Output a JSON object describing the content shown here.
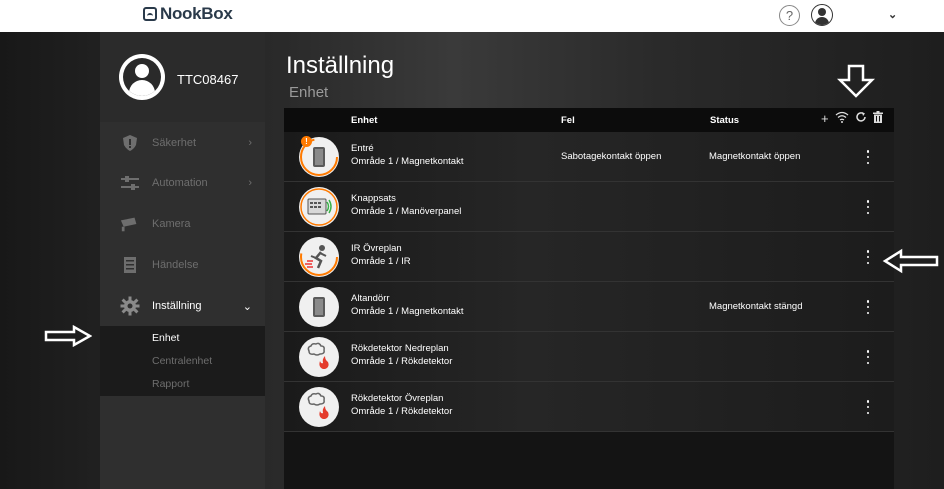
{
  "app": {
    "logo_text": "NookBox"
  },
  "header": {
    "help_label": "?"
  },
  "sidebar": {
    "username": "TTC08467",
    "items": [
      {
        "label": "Säkerhet",
        "icon": "shield-icon",
        "chevron": "›"
      },
      {
        "label": "Automation",
        "icon": "sliders-icon",
        "chevron": "›"
      },
      {
        "label": "Kamera",
        "icon": "camera-icon",
        "chevron": ""
      },
      {
        "label": "Händelse",
        "icon": "log-icon",
        "chevron": ""
      },
      {
        "label": "Inställning",
        "icon": "gear-icon",
        "chevron": "⌄"
      }
    ],
    "sub_items": [
      {
        "label": "Enhet"
      },
      {
        "label": "Centralenhet"
      },
      {
        "label": "Rapport"
      }
    ]
  },
  "main": {
    "title": "Inställning",
    "subtitle": "Enhet",
    "columns": {
      "device": "Enhet",
      "fault": "Fel",
      "status": "Status"
    },
    "devices": [
      {
        "name": "Entré",
        "area": "Område 1 / Magnetkontakt",
        "fault": "Sabotagekontakt öppen",
        "status": "Magnetkontakt öppen",
        "icon": "door-contact-icon",
        "badge": "!"
      },
      {
        "name": "Knappsats",
        "area": "Område 1 / Manöverpanel",
        "fault": "",
        "status": "",
        "icon": "keypad-icon"
      },
      {
        "name": "IR Övreplan",
        "area": "Område 1 / IR",
        "fault": "",
        "status": "",
        "icon": "motion-sensor-icon"
      },
      {
        "name": "Altandörr",
        "area": "Område 1 / Magnetkontakt",
        "fault": "",
        "status": "Magnetkontakt stängd",
        "icon": "door-contact-icon"
      },
      {
        "name": "Rökdetektor Nedreplan",
        "area": "Område 1 / Rökdetektor",
        "fault": "",
        "status": "",
        "icon": "smoke-detector-icon"
      },
      {
        "name": "Rökdetektor Övreplan",
        "area": "Område 1 / Rökdetektor",
        "fault": "",
        "status": "",
        "icon": "smoke-detector-icon"
      }
    ]
  },
  "colors": {
    "accent_orange": "#ff7a00",
    "active_text": "#ffffff",
    "inactive_text": "#6e6e6e"
  }
}
